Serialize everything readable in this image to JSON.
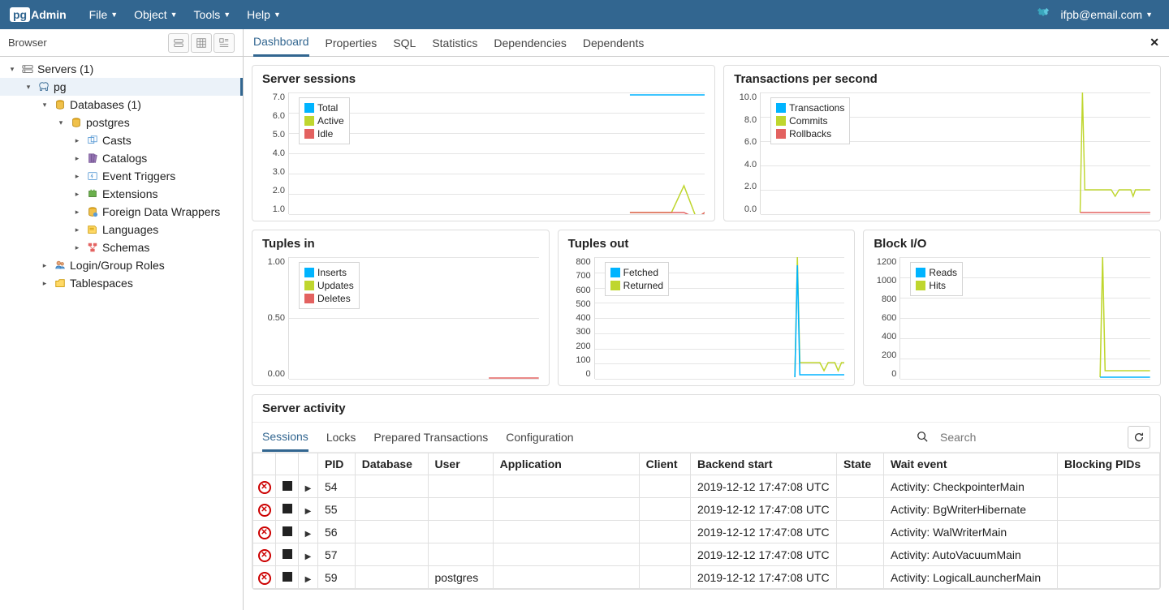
{
  "app": {
    "logo_prefix": "pg",
    "logo_main": "Admin",
    "user": "ifpb@email.com"
  },
  "top_menus": [
    "File",
    "Object",
    "Tools",
    "Help"
  ],
  "browser": {
    "label": "Browser"
  },
  "tree": {
    "servers": "Servers (1)",
    "pg": "pg",
    "databases": "Databases (1)",
    "postgres": "postgres",
    "casts": "Casts",
    "catalogs": "Catalogs",
    "event_triggers": "Event Triggers",
    "extensions": "Extensions",
    "fdw": "Foreign Data Wrappers",
    "languages": "Languages",
    "schemas": "Schemas",
    "login_roles": "Login/Group Roles",
    "tablespaces": "Tablespaces"
  },
  "tabs": {
    "dashboard": "Dashboard",
    "properties": "Properties",
    "sql": "SQL",
    "statistics": "Statistics",
    "dependencies": "Dependencies",
    "dependents": "Dependents"
  },
  "charts": {
    "sessions": {
      "title": "Server sessions",
      "y_ticks": [
        "7.0",
        "6.0",
        "5.0",
        "4.0",
        "3.0",
        "2.0",
        "1.0"
      ],
      "legend": [
        "Total",
        "Active",
        "Idle"
      ]
    },
    "tps": {
      "title": "Transactions per second",
      "y_ticks": [
        "10.0",
        "8.0",
        "6.0",
        "4.0",
        "2.0",
        "0.0"
      ],
      "legend": [
        "Transactions",
        "Commits",
        "Rollbacks"
      ]
    },
    "tuples_in": {
      "title": "Tuples in",
      "y_ticks": [
        "1.00",
        "0.50",
        "0.00"
      ],
      "legend": [
        "Inserts",
        "Updates",
        "Deletes"
      ]
    },
    "tuples_out": {
      "title": "Tuples out",
      "y_ticks": [
        "800",
        "700",
        "600",
        "500",
        "400",
        "300",
        "200",
        "100",
        "0"
      ],
      "legend": [
        "Fetched",
        "Returned"
      ]
    },
    "block_io": {
      "title": "Block I/O",
      "y_ticks": [
        "1200",
        "1000",
        "800",
        "600",
        "400",
        "200",
        "0"
      ],
      "legend": [
        "Reads",
        "Hits"
      ]
    }
  },
  "activity": {
    "title": "Server activity",
    "tabs": [
      "Sessions",
      "Locks",
      "Prepared Transactions",
      "Configuration"
    ],
    "search_placeholder": "Search",
    "columns": [
      "PID",
      "Database",
      "User",
      "Application",
      "Client",
      "Backend start",
      "State",
      "Wait event",
      "Blocking PIDs"
    ],
    "rows": [
      {
        "pid": "54",
        "database": "",
        "user": "",
        "application": "",
        "client": "",
        "backend_start": "2019-12-12 17:47:08 UTC",
        "state": "",
        "wait_event": "Activity: CheckpointerMain",
        "blocking": ""
      },
      {
        "pid": "55",
        "database": "",
        "user": "",
        "application": "",
        "client": "",
        "backend_start": "2019-12-12 17:47:08 UTC",
        "state": "",
        "wait_event": "Activity: BgWriterHibernate",
        "blocking": ""
      },
      {
        "pid": "56",
        "database": "",
        "user": "",
        "application": "",
        "client": "",
        "backend_start": "2019-12-12 17:47:08 UTC",
        "state": "",
        "wait_event": "Activity: WalWriterMain",
        "blocking": ""
      },
      {
        "pid": "57",
        "database": "",
        "user": "",
        "application": "",
        "client": "",
        "backend_start": "2019-12-12 17:47:08 UTC",
        "state": "",
        "wait_event": "Activity: AutoVacuumMain",
        "blocking": ""
      },
      {
        "pid": "59",
        "database": "",
        "user": "postgres",
        "application": "",
        "client": "",
        "backend_start": "2019-12-12 17:47:08 UTC",
        "state": "",
        "wait_event": "Activity: LogicalLauncherMain",
        "blocking": ""
      }
    ]
  },
  "chart_data": [
    {
      "type": "line",
      "title": "Server sessions",
      "ylim": [
        1,
        7
      ],
      "series": [
        {
          "name": "Total",
          "values": [
            7,
            7
          ]
        },
        {
          "name": "Active",
          "values": [
            1,
            1,
            1,
            2,
            1
          ]
        },
        {
          "name": "Idle",
          "values": [
            1,
            1,
            1,
            0.5,
            1
          ]
        }
      ]
    },
    {
      "type": "line",
      "title": "Transactions per second",
      "ylim": [
        0,
        10
      ],
      "series": [
        {
          "name": "Transactions",
          "values": [
            0,
            0
          ]
        },
        {
          "name": "Commits",
          "values": [
            0,
            10,
            2,
            1.5,
            2,
            2
          ]
        },
        {
          "name": "Rollbacks",
          "values": [
            0,
            0,
            0,
            0,
            0,
            0
          ]
        }
      ]
    },
    {
      "type": "line",
      "title": "Tuples in",
      "ylim": [
        0,
        1
      ],
      "series": [
        {
          "name": "Inserts",
          "values": [
            0,
            0
          ]
        },
        {
          "name": "Updates",
          "values": [
            0,
            0
          ]
        },
        {
          "name": "Deletes",
          "values": [
            0,
            0
          ]
        }
      ]
    },
    {
      "type": "line",
      "title": "Tuples out",
      "ylim": [
        0,
        800
      ],
      "series": [
        {
          "name": "Fetched",
          "values": [
            0,
            800,
            100,
            80,
            100,
            100
          ]
        },
        {
          "name": "Returned",
          "values": [
            0,
            800,
            100,
            80,
            100,
            100
          ]
        }
      ]
    },
    {
      "type": "line",
      "title": "Block I/O",
      "ylim": [
        0,
        1200
      ],
      "series": [
        {
          "name": "Reads",
          "values": [
            0,
            0
          ]
        },
        {
          "name": "Hits",
          "values": [
            0,
            1200,
            60,
            60,
            60
          ]
        }
      ]
    }
  ]
}
